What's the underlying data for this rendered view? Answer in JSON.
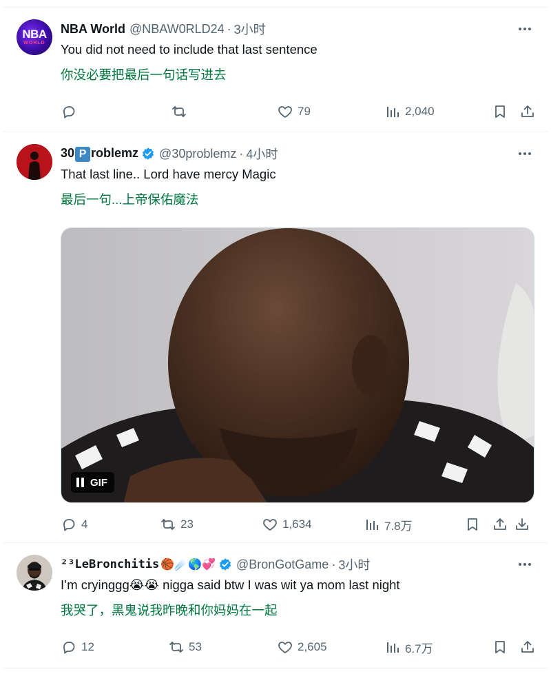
{
  "tweets": [
    {
      "name": "NBA World",
      "handle": "@NBAW0RLD24",
      "time": "3小时",
      "text": "You did not need to include that last sentence",
      "translation": "你没必要把最后一句话写进去",
      "avatar_text": "NBA",
      "avatar_subtext": "WORLD",
      "replies": "",
      "retweets": "",
      "likes": "79",
      "views": "2,040"
    },
    {
      "name_prefix": "30",
      "name_box": "P",
      "name_suffix": "roblemz",
      "handle": "@30problemz",
      "time": "4小时",
      "text": "That last line.. Lord have mercy Magic",
      "translation": "最后一句...上帝保佑魔法",
      "gif_label": "GIF",
      "replies": "4",
      "retweets": "23",
      "likes": "1,634",
      "views": "7.8万"
    },
    {
      "name": "²³LeBronchitis",
      "name_emojis": "🏀☄️🌎💞",
      "handle": "@BronGotGame",
      "time": "3小时",
      "text_a": "I’m cryinggg",
      "text_emojis": "😭😭",
      "text_b": " nigga said btw I was wit ya mom last night",
      "translation": "我哭了，黑鬼说我昨晚和你妈妈在一起",
      "replies": "12",
      "retweets": "53",
      "likes": "2,605",
      "views": "6.7万"
    }
  ],
  "separator_dot": "·",
  "colors": {
    "text": "#0f1419",
    "secondary": "#536471",
    "translation": "#00793f",
    "verified": "#1d9bf0",
    "border": "#eff3f4"
  }
}
